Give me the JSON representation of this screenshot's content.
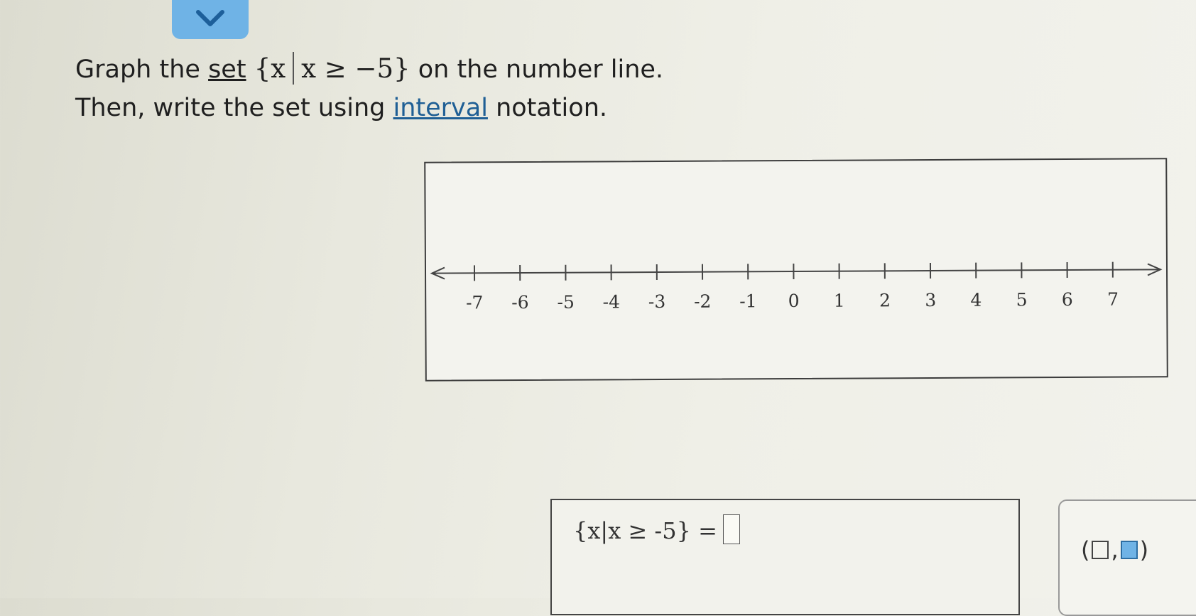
{
  "prompt": {
    "line1_prefix": "Graph the ",
    "set_link": "set",
    "set_expr_open": "{x",
    "set_expr_cond": "x ≥ −5}",
    "line1_suffix": " on the number line.",
    "line2_prefix": "Then, write the set using ",
    "interval_link": "interval",
    "line2_suffix": " notation."
  },
  "number_line": {
    "ticks": [
      "-7",
      "-6",
      "-5",
      "-4",
      "-3",
      "-2",
      "-1",
      "0",
      "1",
      "2",
      "3",
      "4",
      "5",
      "6",
      "7"
    ]
  },
  "answer": {
    "expression": "{x|x ≥ -5} ="
  },
  "palette": {
    "open_paren": "(",
    "comma": ",",
    "close_paren": ")"
  },
  "colors": {
    "accent": "#6fb3e6",
    "link": "#1f5f95"
  },
  "icons": {
    "collapse": "chevron-down-icon"
  }
}
